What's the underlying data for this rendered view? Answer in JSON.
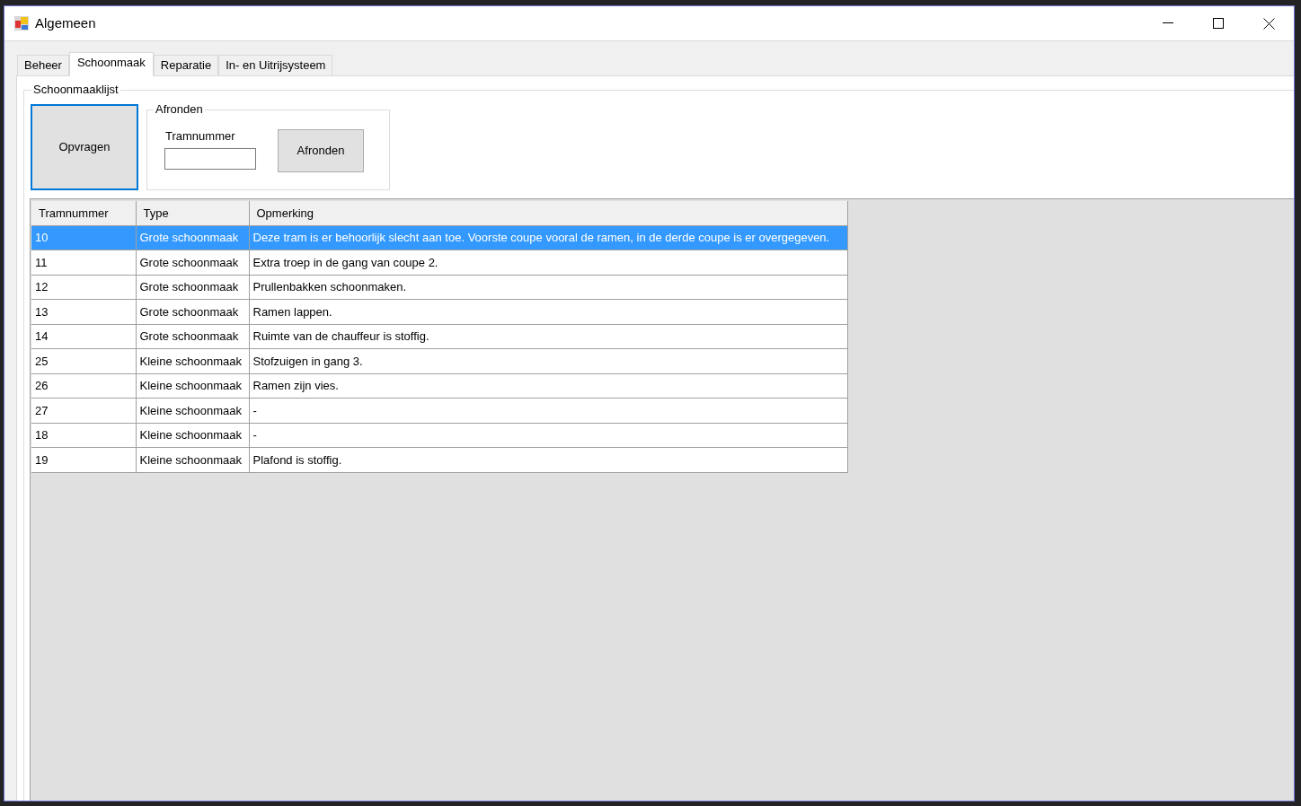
{
  "window": {
    "title": "Algemeen"
  },
  "tabs": [
    {
      "label": "Beheer",
      "selected": false
    },
    {
      "label": "Schoonmaak",
      "selected": true
    },
    {
      "label": "Reparatie",
      "selected": false
    },
    {
      "label": "In- en Uitrijsysteem",
      "selected": false
    }
  ],
  "groupbox": {
    "title": "Schoonmaaklijst",
    "query_button": "Opvragen",
    "finish_group": {
      "title": "Afronden",
      "field_label": "Tramnummer",
      "button": "Afronden"
    }
  },
  "table": {
    "columns": [
      "Tramnummer",
      "Type",
      "Opmerking"
    ],
    "rows": [
      {
        "cells": [
          "10",
          "Grote schoonmaak",
          "Deze tram is er behoorlijk slecht aan toe. Voorste coupe vooral de ramen, in de derde coupe is er overgegeven."
        ],
        "selected": true
      },
      {
        "cells": [
          "11",
          "Grote schoonmaak",
          "Extra troep in de gang van coupe 2."
        ],
        "selected": false
      },
      {
        "cells": [
          "12",
          "Grote schoonmaak",
          "Prullenbakken schoonmaken."
        ],
        "selected": false
      },
      {
        "cells": [
          "13",
          "Grote schoonmaak",
          "Ramen lappen."
        ],
        "selected": false
      },
      {
        "cells": [
          "14",
          "Grote schoonmaak",
          "Ruimte van de chauffeur is stoffig."
        ],
        "selected": false
      },
      {
        "cells": [
          "25",
          "Kleine schoonmaak",
          "Stofzuigen in gang 3."
        ],
        "selected": false
      },
      {
        "cells": [
          "26",
          "Kleine schoonmaak",
          "Ramen zijn vies."
        ],
        "selected": false
      },
      {
        "cells": [
          "27",
          "Kleine schoonmaak",
          "-"
        ],
        "selected": false
      },
      {
        "cells": [
          "18",
          "Kleine schoonmaak",
          "-"
        ],
        "selected": false
      },
      {
        "cells": [
          "19",
          "Kleine schoonmaak",
          "Plafond is stoffig."
        ],
        "selected": false
      }
    ]
  }
}
